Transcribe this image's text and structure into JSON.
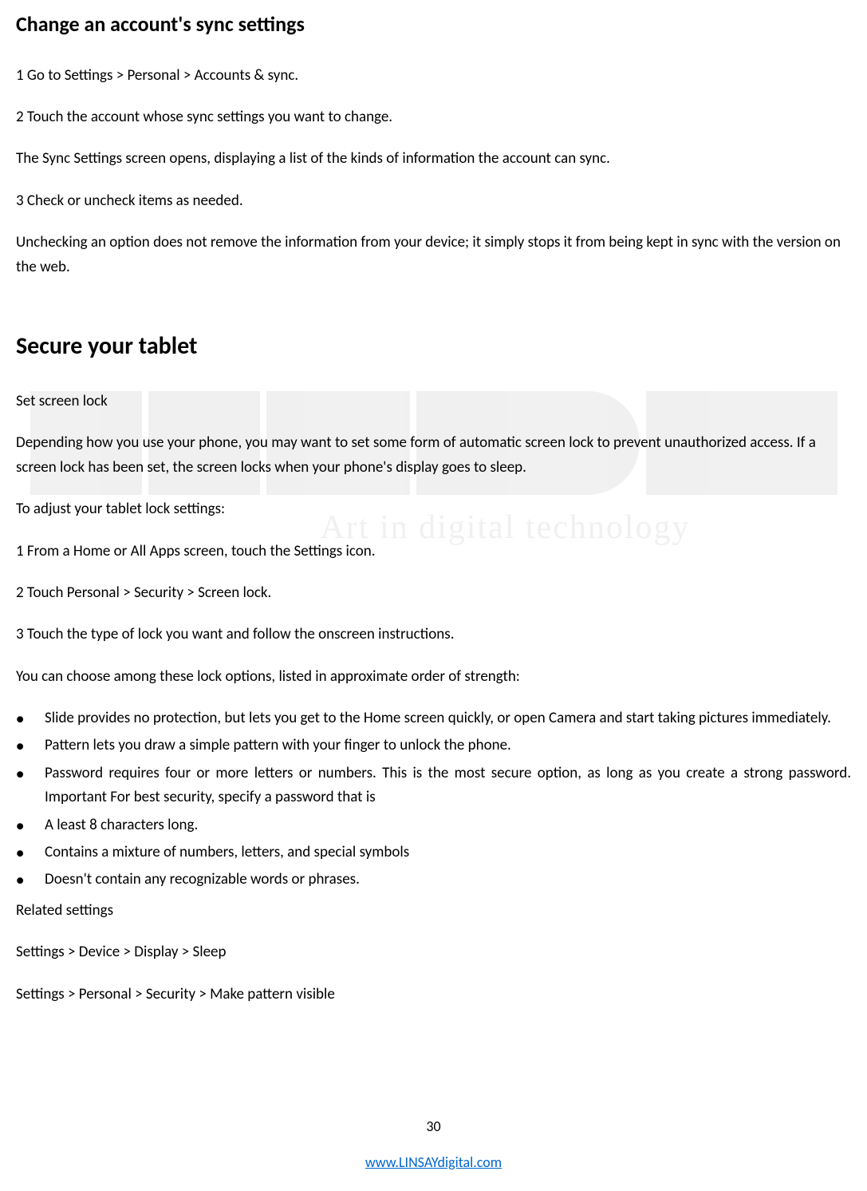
{
  "section1": {
    "title": "Change an account's sync settings",
    "p1": "1 Go to Settings > Personal > Accounts & sync.",
    "p2": "2 Touch the account whose sync settings you want to change.",
    "p3": "The Sync Settings screen opens, displaying a list of the kinds of information the account can sync.",
    "p4": "3 Check or uncheck items as needed.",
    "p5": "Unchecking an option does not remove the information from your device; it simply stops it from being kept in sync with the version on the web."
  },
  "section2": {
    "title": "Secure your tablet",
    "p1": "Set screen lock",
    "p2": "Depending how you use your phone, you may want to set some form of automatic screen lock to prevent unauthorized access. If a screen lock has been set, the screen locks when your phone's display goes to sleep.",
    "p3": "To adjust your tablet lock settings:",
    "p4": "1 From a Home or All Apps screen, touch the Settings icon.",
    "p5": "2 Touch Personal > Security > Screen lock.",
    "p6": "3 Touch the type of lock you want and follow the onscreen instructions.",
    "p7": "You can choose among these lock options, listed in approximate order of strength:",
    "bullets": [
      "Slide provides no protection, but lets you get to the Home screen quickly, or open Camera and start taking pictures immediately.",
      "Pattern lets you draw a simple pattern with your finger to unlock the phone.",
      "Password requires four or more letters or numbers. This is the most secure option, as long as you create a strong password. Important For best security, specify a password that is",
      "A least 8 characters long.",
      "Contains a mixture of numbers, letters, and special symbols",
      "Doesn't contain any recognizable words or phrases."
    ],
    "p8": "Related settings",
    "p9": "Settings > Device > Display > Sleep",
    "p10": "Settings > Personal > Security > Make pattern visible"
  },
  "watermark": {
    "tagline": "Art in digital technology"
  },
  "footer": {
    "page_number": "30",
    "link": "www.LINSAYdigital.com"
  }
}
